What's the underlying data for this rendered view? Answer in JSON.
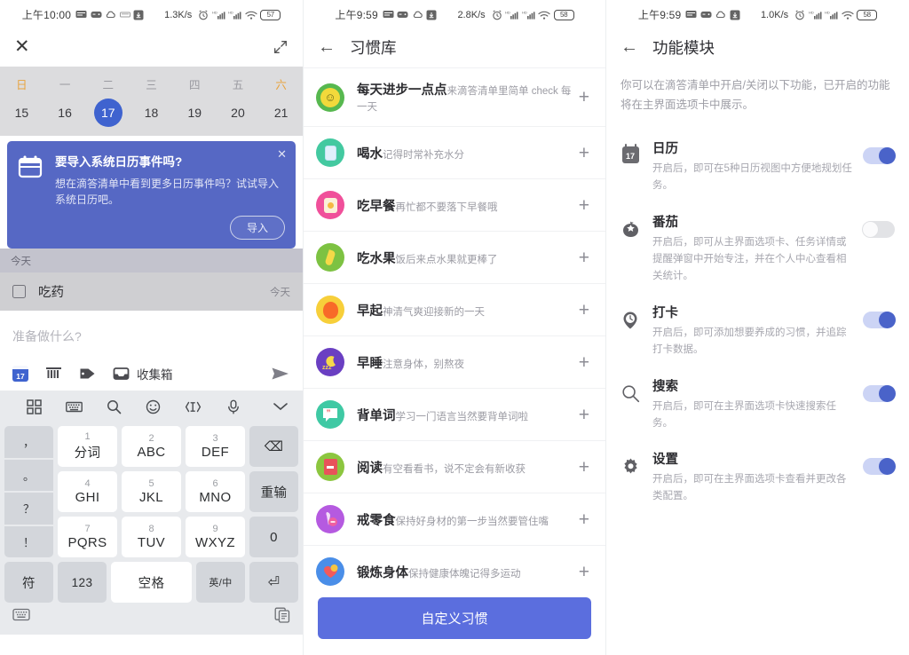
{
  "panel1": {
    "status": {
      "time": "上午10:00",
      "net_speed": "1.3K/s",
      "battery": "57",
      "icons": [
        "sms-icon",
        "game-icon",
        "cloud-icon",
        "card-icon",
        "download-icon",
        "alarm-icon",
        "signal-icon",
        "signal2-icon",
        "wifi-icon"
      ]
    },
    "topbar": {
      "close": "✕",
      "expand": "expand-icon"
    },
    "calendar": {
      "weekdays": [
        "日",
        "一",
        "二",
        "三",
        "四",
        "五",
        "六"
      ],
      "days": [
        "15",
        "16",
        "17",
        "18",
        "19",
        "20",
        "21"
      ],
      "selected_index": 2,
      "weekend_color": "#e8a33d",
      "selected_color": "#3f63cf"
    },
    "banner": {
      "title": "要导入系统日历事件吗?",
      "desc": "想在滴答清单中看到更多日历事件吗？试试导入系统日历吧。",
      "button": "导入",
      "close": "✕",
      "bg": "#5668c4"
    },
    "section_label": "今天",
    "task": {
      "name": "吃药",
      "due": "今天"
    },
    "composer": {
      "placeholder": "准备做什么?",
      "list_label": "收集箱",
      "icons": [
        "date-icon",
        "priority-icon",
        "tag-icon",
        "inbox-icon",
        "send-icon"
      ]
    },
    "keyboard": {
      "tools": [
        "grid-icon",
        "keyboard-icon",
        "search-icon",
        "emoji-icon",
        "cursor-icon",
        "mic-icon",
        "chevron-down-icon"
      ],
      "side_left": [
        "，",
        "。",
        "？",
        "！"
      ],
      "keys": [
        {
          "num": "1",
          "label": "分词"
        },
        {
          "num": "2",
          "label": "ABC"
        },
        {
          "num": "3",
          "label": "DEF"
        },
        {
          "num": "4",
          "label": "GHI"
        },
        {
          "num": "5",
          "label": "JKL"
        },
        {
          "num": "6",
          "label": "MNO"
        },
        {
          "num": "7",
          "label": "PQRS"
        },
        {
          "num": "8",
          "label": "TUV"
        },
        {
          "num": "9",
          "label": "WXYZ"
        }
      ],
      "side_right": [
        "⌫",
        "重输",
        "0"
      ],
      "bottom_row": [
        "符",
        "123",
        "空格",
        "英/中",
        "⏎"
      ],
      "nav": [
        "keyboard-switch-icon",
        "clipboard-icon"
      ]
    }
  },
  "panel2": {
    "status": {
      "time": "上午9:59",
      "net_speed": "2.8K/s",
      "battery": "58"
    },
    "title": "习惯库",
    "back": "←",
    "habits": [
      {
        "name": "每天进步一点点",
        "desc": "来滴答清单里简单 check 每一天",
        "color1": "#57b84f",
        "color2": "#f2d93b",
        "glyph": "☺",
        "add": "+"
      },
      {
        "name": "喝水",
        "desc": "记得时常补充水分",
        "color1": "#43c9a0",
        "color2": "#bfe3f5",
        "glyph": "▯",
        "add": "+"
      },
      {
        "name": "吃早餐",
        "desc": "再忙都不要落下早餐哦",
        "color1": "#f0509a",
        "color2": "#f7e7c2",
        "glyph": "▣",
        "add": "+"
      },
      {
        "name": "吃水果",
        "desc": "饭后来点水果就更棒了",
        "color1": "#7dc242",
        "color2": "#f5d948",
        "glyph": "🍌",
        "add": "+"
      },
      {
        "name": "早起",
        "desc": "神清气爽迎接新的一天",
        "color1": "#f7cf3a",
        "color2": "#f86a28",
        "glyph": "●",
        "add": "+"
      },
      {
        "name": "早睡",
        "desc": "注意身体，别熬夜",
        "color1": "#6a3fc2",
        "color2": "#f5d94a",
        "glyph": "☾",
        "add": "+"
      },
      {
        "name": "背单词",
        "desc": "学习一门语言当然要背单词啦",
        "color1": "#3fc9a4",
        "color2": "#f0565a",
        "glyph": "❞",
        "add": "+"
      },
      {
        "name": "阅读",
        "desc": "有空看看书，说不定会有新收获",
        "color1": "#8cc63f",
        "color2": "#e8535a",
        "glyph": "▤",
        "add": "+"
      },
      {
        "name": "戒零食",
        "desc": "保持好身材的第一步当然要管住嘴",
        "color1": "#b55ae0",
        "color2": "#f05fa0",
        "glyph": "🍦",
        "add": "+"
      },
      {
        "name": "锻炼身体",
        "desc": "保持健康体魄记得多运动",
        "color1": "#4a8ee8",
        "color2": "#f25a5a",
        "glyph": "❤",
        "add": "+"
      }
    ],
    "cta": "自定义习惯",
    "cta_color": "#5b6ede"
  },
  "panel3": {
    "status": {
      "time": "上午9:59",
      "net_speed": "1.0K/s",
      "battery": "58"
    },
    "title": "功能模块",
    "back": "←",
    "intro": "你可以在滴答清单中开启/关闭以下功能，已开启的功能将在主界面选项卡中展示。",
    "features": [
      {
        "icon": "calendar-17-icon",
        "name": "日历",
        "desc": "开启后，即可在5种日历视图中方便地规划任务。",
        "on": true
      },
      {
        "icon": "tomato-icon",
        "name": "番茄",
        "desc": "开启后，即可从主界面选项卡、任务详情或提醒弹窗中开始专注，并在个人中心查看相关统计。",
        "on": false
      },
      {
        "icon": "checkin-clock-icon",
        "name": "打卡",
        "desc": "开启后，即可添加想要养成的习惯，并追踪打卡数据。",
        "on": true
      },
      {
        "icon": "search-icon",
        "name": "搜索",
        "desc": "开启后，即可在主界面选项卡快速搜索任务。",
        "on": true
      },
      {
        "icon": "gear-icon",
        "name": "设置",
        "desc": "开启后，即可在主界面选项卡查看并更改各类配置。",
        "on": true
      }
    ],
    "toggle_on_color": "#4a63c9",
    "toggle_track_on": "#ccd4f5"
  }
}
